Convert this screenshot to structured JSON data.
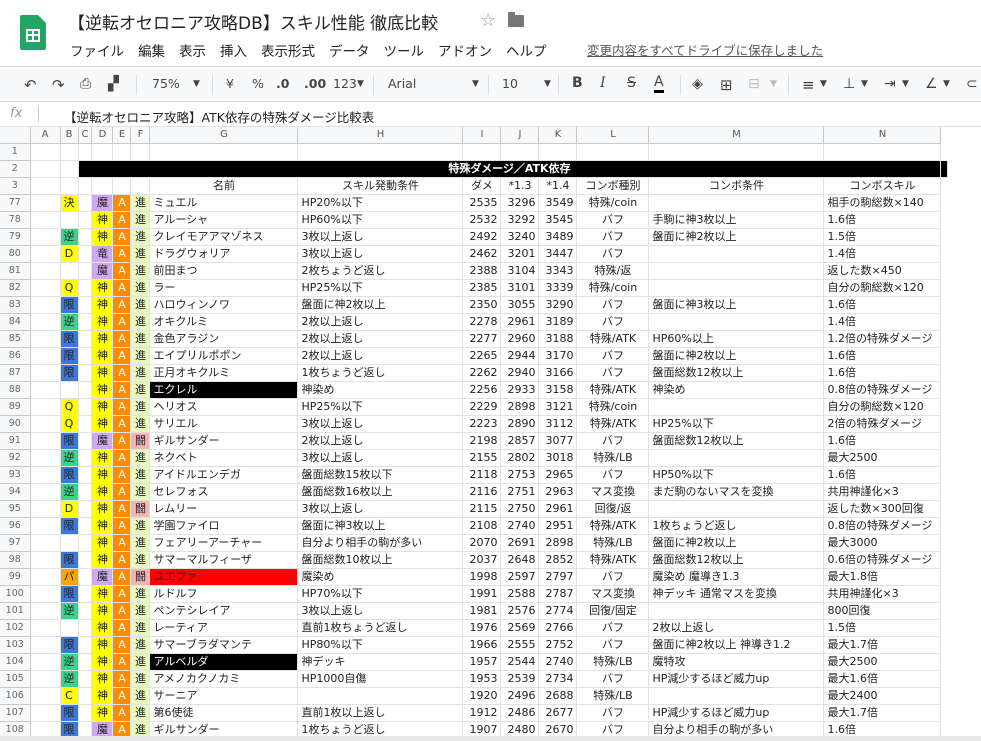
{
  "doc": {
    "title": "【逆転オセロニア攻略DB】スキル性能 徹底比較",
    "saved_status": "変更内容をすべてドライブに保存しました"
  },
  "menu": [
    "ファイル",
    "編集",
    "表示",
    "挿入",
    "表示形式",
    "データ",
    "ツール",
    "アドオン",
    "ヘルプ"
  ],
  "toolbar": {
    "zoom": "75%",
    "currency": "¥",
    "percent": "%",
    "dec_less": ".0",
    "dec_more": ".00",
    "format_more": "123",
    "font": "Arial",
    "font_size": "10",
    "bold": "B",
    "italic": "I",
    "strike": "S",
    "textcolor": "A"
  },
  "formula": {
    "label": "fx",
    "content": "【逆転オセロニア攻略】ATK依存の特殊ダメージ比較表"
  },
  "columns": [
    "A",
    "B",
    "C",
    "D",
    "E",
    "F",
    "G",
    "H",
    "I",
    "J",
    "K",
    "L",
    "M",
    "N"
  ],
  "header": {
    "title": "特殊ダメージ／ATK依存",
    "name": "名前",
    "cond": "スキル発動条件",
    "dmg": "ダメ",
    "x13": "*1.3",
    "x14": "*1.4",
    "ctype": "コンボ種別",
    "ccond": "コンボ条件",
    "cskill": "コンボスキル"
  },
  "rows": [
    {
      "n": "77",
      "b": "決",
      "bc": "yellow",
      "d": "魔",
      "dc": "purple",
      "e": "A",
      "f": "進",
      "fc": "gcell",
      "name": "ミュエル",
      "cond": "HP20%以下",
      "dmg": "2535",
      "x13": "3296",
      "x14": "3549",
      "ctype": "特殊/coin",
      "ccond": "",
      "cskill": "相手の駒総数×140"
    },
    {
      "n": "78",
      "b": "",
      "bc": "",
      "d": "神",
      "dc": "yellow",
      "e": "A",
      "f": "進",
      "fc": "gcell",
      "name": "アルーシャ",
      "cond": "HP60%以下",
      "dmg": "2532",
      "x13": "3292",
      "x14": "3545",
      "ctype": "バフ",
      "ccond": "手駒に神3枚以上",
      "cskill": "1.6倍"
    },
    {
      "n": "79",
      "b": "逆",
      "bc": "green",
      "d": "神",
      "dc": "yellow",
      "e": "A",
      "f": "進",
      "fc": "gcell",
      "name": "クレイモアアマゾネス",
      "cond": "3枚以上返し",
      "dmg": "2492",
      "x13": "3240",
      "x14": "3489",
      "ctype": "バフ",
      "ccond": "盤面に神2枚以上",
      "cskill": "1.5倍"
    },
    {
      "n": "80",
      "b": "D",
      "bc": "yellow",
      "d": "竜",
      "dc": "purple",
      "e": "A",
      "f": "進",
      "fc": "gcell",
      "name": "ドラグウォリア",
      "cond": "3枚以上返し",
      "dmg": "2462",
      "x13": "3201",
      "x14": "3447",
      "ctype": "バフ",
      "ccond": "",
      "cskill": "1.4倍"
    },
    {
      "n": "81",
      "b": "",
      "bc": "",
      "d": "魔",
      "dc": "purple",
      "e": "A",
      "f": "進",
      "fc": "gcell",
      "name": "前田まつ",
      "cond": "2枚ちょうど返し",
      "dmg": "2388",
      "x13": "3104",
      "x14": "3343",
      "ctype": "特殊/返",
      "ccond": "",
      "cskill": "返した数×450"
    },
    {
      "n": "82",
      "b": "Q",
      "bc": "yellow",
      "d": "神",
      "dc": "yellow",
      "e": "A",
      "f": "進",
      "fc": "gcell",
      "name": "ラー",
      "cond": "HP25%以下",
      "dmg": "2385",
      "x13": "3101",
      "x14": "3339",
      "ctype": "特殊/coin",
      "ccond": "",
      "cskill": "自分の駒総数×120"
    },
    {
      "n": "83",
      "b": "限",
      "bc": "blue",
      "d": "神",
      "dc": "yellow",
      "e": "A",
      "f": "進",
      "fc": "gcell",
      "name": "ハロウィンノワ",
      "cond": "盤面に神2枚以上",
      "dmg": "2350",
      "x13": "3055",
      "x14": "3290",
      "ctype": "バフ",
      "ccond": "盤面に神3枚以上",
      "cskill": "1.6倍"
    },
    {
      "n": "84",
      "b": "逆",
      "bc": "green",
      "d": "神",
      "dc": "yellow",
      "e": "A",
      "f": "進",
      "fc": "gcell",
      "name": "オキクルミ",
      "cond": "2枚以上返し",
      "dmg": "2278",
      "x13": "2961",
      "x14": "3189",
      "ctype": "バフ",
      "ccond": "",
      "cskill": "1.4倍"
    },
    {
      "n": "85",
      "b": "限",
      "bc": "blue",
      "d": "神",
      "dc": "yellow",
      "e": "A",
      "f": "進",
      "fc": "gcell",
      "name": "金色アラジン",
      "cond": "2枚以上返し",
      "dmg": "2277",
      "x13": "2960",
      "x14": "3188",
      "ctype": "特殊/ATK",
      "ccond": "HP60%以上",
      "cskill": "1.2倍の特殊ダメージ"
    },
    {
      "n": "86",
      "b": "限",
      "bc": "blue",
      "d": "神",
      "dc": "yellow",
      "e": "A",
      "f": "進",
      "fc": "gcell",
      "name": "エイプリルポポン",
      "cond": "2枚以上返し",
      "dmg": "2265",
      "x13": "2944",
      "x14": "3170",
      "ctype": "バフ",
      "ccond": "盤面に神2枚以上",
      "cskill": "1.6倍"
    },
    {
      "n": "87",
      "b": "限",
      "bc": "blue",
      "d": "神",
      "dc": "yellow",
      "e": "A",
      "f": "進",
      "fc": "gcell",
      "name": "正月オキクルミ",
      "cond": "1枚ちょうど返し",
      "dmg": "2262",
      "x13": "2940",
      "x14": "3166",
      "ctype": "バフ",
      "ccond": "盤面総数12枚以上",
      "cskill": "1.6倍"
    },
    {
      "n": "88",
      "b": "",
      "bc": "",
      "d": "神",
      "dc": "yellow",
      "e": "A",
      "f": "進",
      "fc": "gcell",
      "name": "エクレル",
      "nc": "bk",
      "cond": "神染め",
      "dmg": "2256",
      "x13": "2933",
      "x14": "3158",
      "ctype": "特殊/ATK",
      "ccond": "神染め",
      "cskill": "0.8倍の特殊ダメージ"
    },
    {
      "n": "89",
      "b": "Q",
      "bc": "yellow",
      "d": "神",
      "dc": "yellow",
      "e": "A",
      "f": "進",
      "fc": "gcell",
      "name": "ヘリオス",
      "cond": "HP25%以下",
      "dmg": "2229",
      "x13": "2898",
      "x14": "3121",
      "ctype": "特殊/coin",
      "ccond": "",
      "cskill": "自分の駒総数×120"
    },
    {
      "n": "90",
      "b": "Q",
      "bc": "yellow",
      "d": "神",
      "dc": "yellow",
      "e": "A",
      "f": "進",
      "fc": "gcell",
      "name": "サリエル",
      "cond": "3枚以上返し",
      "dmg": "2223",
      "x13": "2890",
      "x14": "3112",
      "ctype": "特殊/ATK",
      "ccond": "HP25%以下",
      "cskill": "2倍の特殊ダメージ"
    },
    {
      "n": "91",
      "b": "限",
      "bc": "blue",
      "d": "魔",
      "dc": "purple",
      "e": "A",
      "f": "闘",
      "fc": "pink",
      "name": "ギルサンダー",
      "cond": "2枚以上返し",
      "dmg": "2198",
      "x13": "2857",
      "x14": "3077",
      "ctype": "バフ",
      "ccond": "盤面総数12枚以上",
      "cskill": "1.6倍"
    },
    {
      "n": "92",
      "b": "逆",
      "bc": "green",
      "d": "神",
      "dc": "yellow",
      "e": "A",
      "f": "進",
      "fc": "gcell",
      "name": "ネクベト",
      "cond": "3枚以上返し",
      "dmg": "2155",
      "x13": "2802",
      "x14": "3018",
      "ctype": "特殊/LB",
      "ccond": "",
      "cskill": "最大2500"
    },
    {
      "n": "93",
      "b": "限",
      "bc": "blue",
      "d": "神",
      "dc": "yellow",
      "e": "A",
      "f": "進",
      "fc": "gcell",
      "name": "アイドルエンデガ",
      "cond": "盤面総数15枚以下",
      "dmg": "2118",
      "x13": "2753",
      "x14": "2965",
      "ctype": "バフ",
      "ccond": "HP50%以下",
      "cskill": "1.6倍"
    },
    {
      "n": "94",
      "b": "逆",
      "bc": "green",
      "d": "神",
      "dc": "yellow",
      "e": "A",
      "f": "進",
      "fc": "gcell",
      "name": "セレフォス",
      "cond": "盤面総数16枚以上",
      "dmg": "2116",
      "x13": "2751",
      "x14": "2963",
      "ctype": "マス変換",
      "ccond": "まだ駒のないマスを変換",
      "cskill": "共用神謹化×3"
    },
    {
      "n": "95",
      "b": "D",
      "bc": "yellow",
      "d": "神",
      "dc": "yellow",
      "e": "A",
      "f": "闘",
      "fc": "pink",
      "name": "レムリー",
      "cond": "3枚以上返し",
      "dmg": "2115",
      "x13": "2750",
      "x14": "2961",
      "ctype": "回復/返",
      "ccond": "",
      "cskill": "返した数×300回復"
    },
    {
      "n": "96",
      "b": "限",
      "bc": "blue",
      "d": "神",
      "dc": "yellow",
      "e": "A",
      "f": "進",
      "fc": "gcell",
      "name": "学園ファイロ",
      "cond": "盤面に神3枚以上",
      "dmg": "2108",
      "x13": "2740",
      "x14": "2951",
      "ctype": "特殊/ATK",
      "ccond": "1枚ちょうど返し",
      "cskill": "0.8倍の特殊ダメージ"
    },
    {
      "n": "97",
      "b": "",
      "bc": "",
      "d": "神",
      "dc": "yellow",
      "e": "A",
      "f": "進",
      "fc": "gcell",
      "name": "フェアリーアーチャー",
      "cond": "自分より相手の駒が多い",
      "dmg": "2070",
      "x13": "2691",
      "x14": "2898",
      "ctype": "特殊/LB",
      "ccond": "盤面に神2枚以上",
      "cskill": "最大3000"
    },
    {
      "n": "98",
      "b": "限",
      "bc": "blue",
      "d": "神",
      "dc": "yellow",
      "e": "A",
      "f": "進",
      "fc": "gcell",
      "name": "サマーマルフィーザ",
      "cond": "盤面総数10枚以上",
      "dmg": "2037",
      "x13": "2648",
      "x14": "2852",
      "ctype": "特殊/ATK",
      "ccond": "盤面総数12枚以上",
      "cskill": "0.6倍の特殊ダメージ"
    },
    {
      "n": "99",
      "b": "パ",
      "bc": "orange",
      "d": "魔",
      "dc": "purple",
      "e": "A",
      "f": "闘",
      "fc": "pink",
      "name": "ユエファ",
      "nc": "red",
      "cond": "魔染め",
      "dmg": "1998",
      "x13": "2597",
      "x14": "2797",
      "ctype": "バフ",
      "ccond": "魔染め 魔導き1.3",
      "cskill": "最大1.8倍"
    },
    {
      "n": "100",
      "b": "限",
      "bc": "blue",
      "d": "神",
      "dc": "yellow",
      "e": "A",
      "f": "進",
      "fc": "gcell",
      "name": "ルドルフ",
      "cond": "HP70%以下",
      "dmg": "1991",
      "x13": "2588",
      "x14": "2787",
      "ctype": "マス変換",
      "ccond": "神デッキ 通常マスを変換",
      "cskill": "共用神謹化×3"
    },
    {
      "n": "101",
      "b": "逆",
      "bc": "green",
      "d": "神",
      "dc": "yellow",
      "e": "A",
      "f": "進",
      "fc": "gcell",
      "name": "ペンテシレイア",
      "cond": "3枚以上返し",
      "dmg": "1981",
      "x13": "2576",
      "x14": "2774",
      "ctype": "回復/固定",
      "ccond": "",
      "cskill": "800回復"
    },
    {
      "n": "102",
      "b": "",
      "bc": "",
      "d": "神",
      "dc": "yellow",
      "e": "A",
      "f": "進",
      "fc": "gcell",
      "name": "レーティア",
      "cond": "直前1枚ちょうど返し",
      "dmg": "1976",
      "x13": "2569",
      "x14": "2766",
      "ctype": "バフ",
      "ccond": "2枚以上返し",
      "cskill": "1.5倍"
    },
    {
      "n": "103",
      "b": "限",
      "bc": "blue",
      "d": "神",
      "dc": "yellow",
      "e": "A",
      "f": "進",
      "fc": "gcell",
      "name": "サマーブラダマンテ",
      "cond": "HP80%以下",
      "dmg": "1966",
      "x13": "2555",
      "x14": "2752",
      "ctype": "バフ",
      "ccond": "盤面に神2枚以上 神導き1.2",
      "cskill": "最大1.7倍"
    },
    {
      "n": "104",
      "b": "逆",
      "bc": "green",
      "d": "神",
      "dc": "yellow",
      "e": "A",
      "f": "進",
      "fc": "gcell",
      "name": "アルベルダ",
      "nc": "bk",
      "cond": "神デッキ",
      "dmg": "1957",
      "x13": "2544",
      "x14": "2740",
      "ctype": "特殊/LB",
      "ccond": "魔特攻",
      "cskill": "最大2500"
    },
    {
      "n": "105",
      "b": "逆",
      "bc": "green",
      "d": "神",
      "dc": "yellow",
      "e": "A",
      "f": "進",
      "fc": "gcell",
      "name": "アメノカクノカミ",
      "cond": "HP1000自傷",
      "dmg": "1953",
      "x13": "2539",
      "x14": "2734",
      "ctype": "バフ",
      "ccond": "HP減少するほど威力up",
      "cskill": "最大1.6倍"
    },
    {
      "n": "106",
      "b": "C",
      "bc": "yellow",
      "d": "神",
      "dc": "yellow",
      "e": "A",
      "f": "進",
      "fc": "gcell",
      "name": "サーニア",
      "cond": "",
      "dmg": "1920",
      "x13": "2496",
      "x14": "2688",
      "ctype": "特殊/LB",
      "ccond": "",
      "cskill": "最大2400"
    },
    {
      "n": "107",
      "b": "限",
      "bc": "blue",
      "d": "神",
      "dc": "yellow",
      "e": "A",
      "f": "進",
      "fc": "gcell",
      "name": "第6使徒",
      "cond": "直前1枚以上返し",
      "dmg": "1912",
      "x13": "2486",
      "x14": "2677",
      "ctype": "バフ",
      "ccond": "HP減少するほど威力up",
      "cskill": "最大1.7倍"
    },
    {
      "n": "108",
      "b": "限",
      "bc": "blue",
      "d": "魔",
      "dc": "purple",
      "e": "A",
      "f": "進",
      "fc": "gcell",
      "name": "ギルサンダー",
      "cond": "1枚ちょうど返し",
      "dmg": "1907",
      "x13": "2480",
      "x14": "2670",
      "ctype": "バフ",
      "ccond": "自分より相手の駒が多い",
      "cskill": "1.6倍"
    }
  ]
}
